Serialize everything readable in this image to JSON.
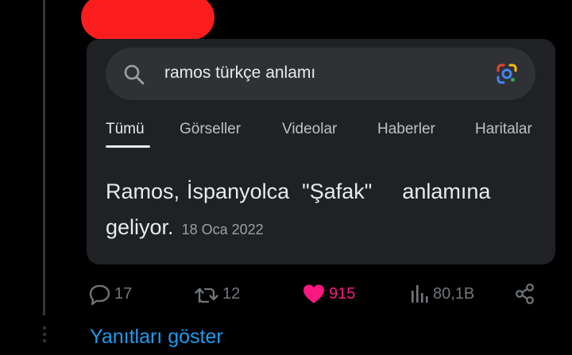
{
  "search": {
    "query": "ramos türkçe anlamı",
    "icon": "search-icon",
    "lens_icon": "google-lens-icon"
  },
  "tabs": [
    {
      "label": "Tümü",
      "active": true
    },
    {
      "label": "Görseller",
      "active": false
    },
    {
      "label": "Videolar",
      "active": false
    },
    {
      "label": "Haberler",
      "active": false
    },
    {
      "label": "Haritalar",
      "active": false
    }
  ],
  "answer": {
    "line1_words": [
      "Ramos,",
      "İspanyolca",
      "\"Şafak\"",
      "anlamına"
    ],
    "line2": "geliyor.",
    "date": "18 Oca 2022"
  },
  "actions": {
    "replies": "17",
    "reposts": "12",
    "likes": "915",
    "views": "80,1B"
  },
  "show_replies": "Yanıtları göster",
  "colors": {
    "background": "#000000",
    "card": "#202124",
    "search_bar": "#303134",
    "like": "#f91880",
    "link": "#1d9bf0",
    "redaction": "#fb1d1d"
  }
}
